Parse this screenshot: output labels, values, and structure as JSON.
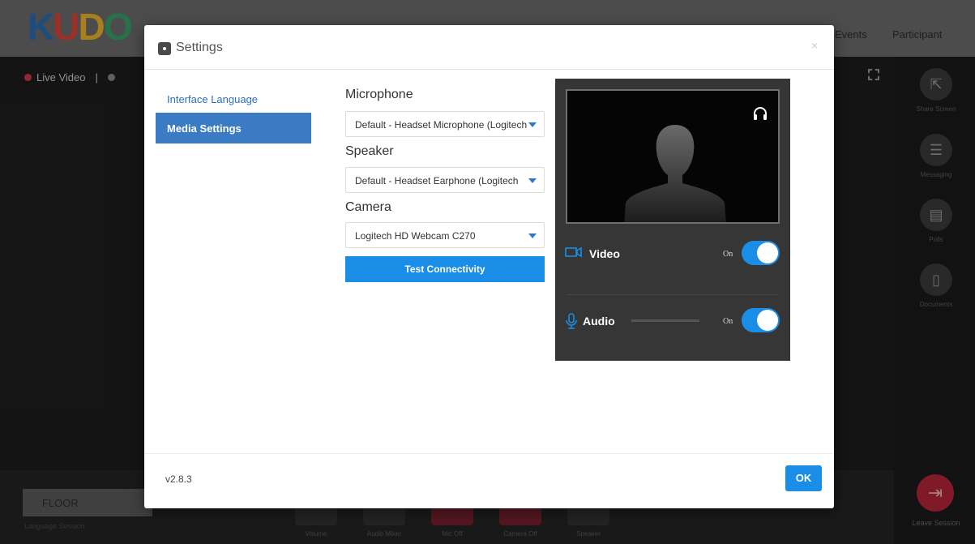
{
  "app": {
    "logo_text": [
      "K",
      "U",
      "D",
      "O"
    ],
    "header_links": [
      "Events",
      "Participant"
    ],
    "live_video_label": "Live Video",
    "live_separator": "|",
    "rail": [
      "Share Screen",
      "Messaging",
      "Polls",
      "Documents"
    ],
    "leave_label": "Leave Session",
    "floor_label": "FLOOR",
    "floor_sub": "Language Session",
    "controls": [
      "Volume",
      "Audio Mixer",
      "Mic Off",
      "Camera Off",
      "Speaker"
    ]
  },
  "settings": {
    "title": "Settings",
    "close_symbol": "×",
    "nav": {
      "interface_language": "Interface Language",
      "media_settings": "Media Settings"
    },
    "microphone": {
      "label": "Microphone",
      "value": "Default - Headset Microphone (Logitech"
    },
    "speaker": {
      "label": "Speaker",
      "value": "Default - Headset Earphone (Logitech"
    },
    "camera": {
      "label": "Camera",
      "value": "Logitech HD Webcam C270"
    },
    "test_connectivity": "Test Connectivity",
    "preview": {
      "video_label": "Video",
      "video_state": "On",
      "audio_label": "Audio",
      "audio_state": "On"
    },
    "version": "v2.8.3",
    "ok": "OK"
  },
  "colors": {
    "accent": "#1a8ee6",
    "nav_active": "#3a7bc4",
    "leave": "#b8243a"
  }
}
